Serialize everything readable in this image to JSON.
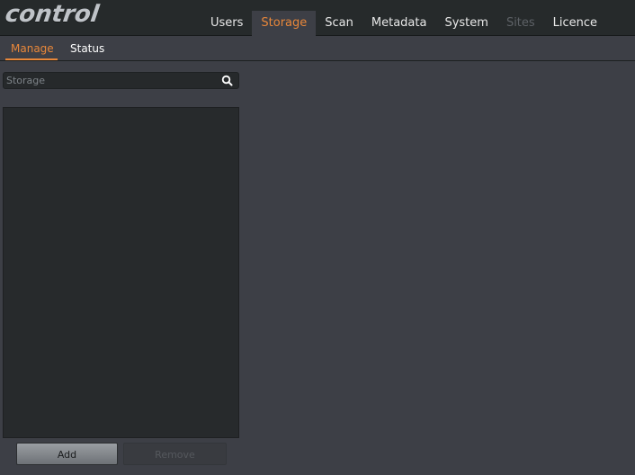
{
  "app": {
    "logo_text": "control"
  },
  "nav": {
    "tabs": [
      {
        "label": "Users",
        "state": "normal"
      },
      {
        "label": "Storage",
        "state": "active"
      },
      {
        "label": "Scan",
        "state": "normal"
      },
      {
        "label": "Metadata",
        "state": "normal"
      },
      {
        "label": "System",
        "state": "normal"
      },
      {
        "label": "Sites",
        "state": "disabled"
      },
      {
        "label": "Licence",
        "state": "normal"
      }
    ]
  },
  "subtabs": {
    "manage": "Manage",
    "status": "Status",
    "active": "Manage"
  },
  "search": {
    "placeholder": "Storage",
    "value": "",
    "icon": "search-icon"
  },
  "storage_list": {
    "items": []
  },
  "buttons": {
    "add": "Add",
    "remove": "Remove"
  },
  "colors": {
    "accent": "#e8873a",
    "background": "#3d3f46",
    "topbar": "#262a2b",
    "panel": "#272a2c"
  }
}
